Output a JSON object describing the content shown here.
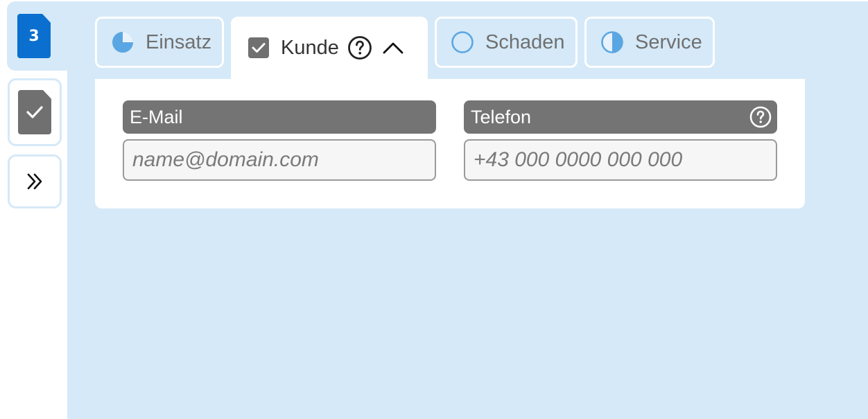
{
  "sidebar": {
    "step_number": "3",
    "done_icon": "check-icon",
    "next_icon": "double-chevron-right-icon"
  },
  "tabs": [
    {
      "label": "Einsatz",
      "icon": "pie-quarter-icon",
      "active": false
    },
    {
      "label": "Kunde",
      "icon": "checkbox-checked-icon",
      "active": true
    },
    {
      "label": "Schaden",
      "icon": "empty-circle-icon",
      "active": false
    },
    {
      "label": "Service",
      "icon": "half-circle-icon",
      "active": false
    }
  ],
  "form": {
    "email": {
      "label": "E-Mail",
      "value": "",
      "placeholder": "name@domain.com"
    },
    "phone": {
      "label": "Telefon",
      "value": "",
      "placeholder": "+43 000 0000 000 000"
    }
  },
  "colors": {
    "background": "#d5e9f8",
    "accent": "#0b6fd0",
    "header_gray": "#747474",
    "icon_blue": "#5aa6e2"
  }
}
